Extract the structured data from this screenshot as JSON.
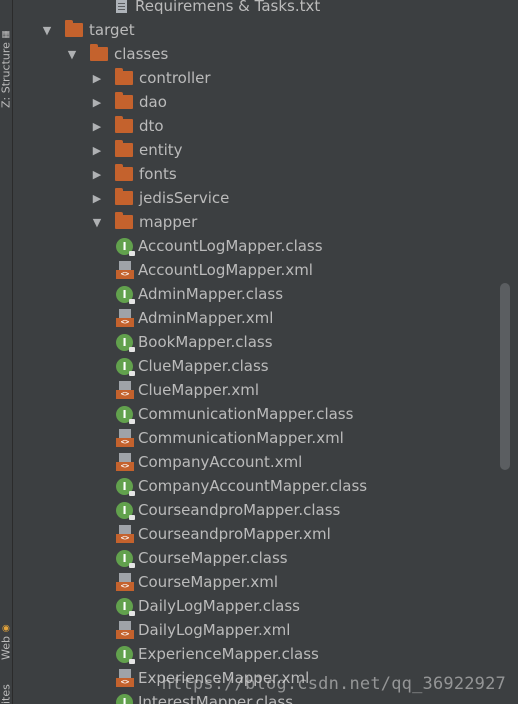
{
  "side_tabs": [
    {
      "label": "Z: Structure",
      "glyph": "▦"
    },
    {
      "label": "Web",
      "glyph": "◉"
    },
    {
      "label": "ites",
      "glyph": ""
    }
  ],
  "tree": [
    {
      "label": "Requiremens & Tasks.txt",
      "type": "txt",
      "depth": 3,
      "arrow": "none"
    },
    {
      "label": "target",
      "type": "folder",
      "depth": 0,
      "arrow": "expanded"
    },
    {
      "label": "classes",
      "type": "folder",
      "depth": 1,
      "arrow": "expanded"
    },
    {
      "label": "controller",
      "type": "folder",
      "depth": 2,
      "arrow": "collapsed"
    },
    {
      "label": "dao",
      "type": "folder",
      "depth": 2,
      "arrow": "collapsed"
    },
    {
      "label": "dto",
      "type": "folder",
      "depth": 2,
      "arrow": "collapsed"
    },
    {
      "label": "entity",
      "type": "folder",
      "depth": 2,
      "arrow": "collapsed"
    },
    {
      "label": "fonts",
      "type": "folder",
      "depth": 2,
      "arrow": "collapsed"
    },
    {
      "label": "jedisService",
      "type": "folder",
      "depth": 2,
      "arrow": "collapsed"
    },
    {
      "label": "mapper",
      "type": "folder",
      "depth": 2,
      "arrow": "expanded"
    },
    {
      "label": "AccountLogMapper.class",
      "type": "class",
      "depth": 3,
      "arrow": "none"
    },
    {
      "label": "AccountLogMapper.xml",
      "type": "xml",
      "depth": 3,
      "arrow": "none"
    },
    {
      "label": "AdminMapper.class",
      "type": "class",
      "depth": 3,
      "arrow": "none"
    },
    {
      "label": "AdminMapper.xml",
      "type": "xml",
      "depth": 3,
      "arrow": "none"
    },
    {
      "label": "BookMapper.class",
      "type": "class",
      "depth": 3,
      "arrow": "none"
    },
    {
      "label": "ClueMapper.class",
      "type": "class",
      "depth": 3,
      "arrow": "none"
    },
    {
      "label": "ClueMapper.xml",
      "type": "xml",
      "depth": 3,
      "arrow": "none"
    },
    {
      "label": "CommunicationMapper.class",
      "type": "class",
      "depth": 3,
      "arrow": "none"
    },
    {
      "label": "CommunicationMapper.xml",
      "type": "xml",
      "depth": 3,
      "arrow": "none"
    },
    {
      "label": "CompanyAccount.xml",
      "type": "xml",
      "depth": 3,
      "arrow": "none"
    },
    {
      "label": "CompanyAccountMapper.class",
      "type": "class",
      "depth": 3,
      "arrow": "none"
    },
    {
      "label": "CourseandproMapper.class",
      "type": "class",
      "depth": 3,
      "arrow": "none"
    },
    {
      "label": "CourseandproMapper.xml",
      "type": "xml",
      "depth": 3,
      "arrow": "none"
    },
    {
      "label": "CourseMapper.class",
      "type": "class",
      "depth": 3,
      "arrow": "none"
    },
    {
      "label": "CourseMapper.xml",
      "type": "xml",
      "depth": 3,
      "arrow": "none"
    },
    {
      "label": "DailyLogMapper.class",
      "type": "class",
      "depth": 3,
      "arrow": "none"
    },
    {
      "label": "DailyLogMapper.xml",
      "type": "xml",
      "depth": 3,
      "arrow": "none"
    },
    {
      "label": "ExperienceMapper.class",
      "type": "class",
      "depth": 3,
      "arrow": "none"
    },
    {
      "label": "ExperienceMapper.xml",
      "type": "xml",
      "depth": 3,
      "arrow": "none"
    },
    {
      "label": "InterestMapper.class",
      "type": "class",
      "depth": 3,
      "arrow": "none"
    }
  ],
  "watermark": "https://blog.csdn.net/qq_36922927",
  "colors": {
    "background": "#3c3f41",
    "text": "#bbbbbb",
    "folder": "#c4622d",
    "class_icon": "#62a14d"
  }
}
